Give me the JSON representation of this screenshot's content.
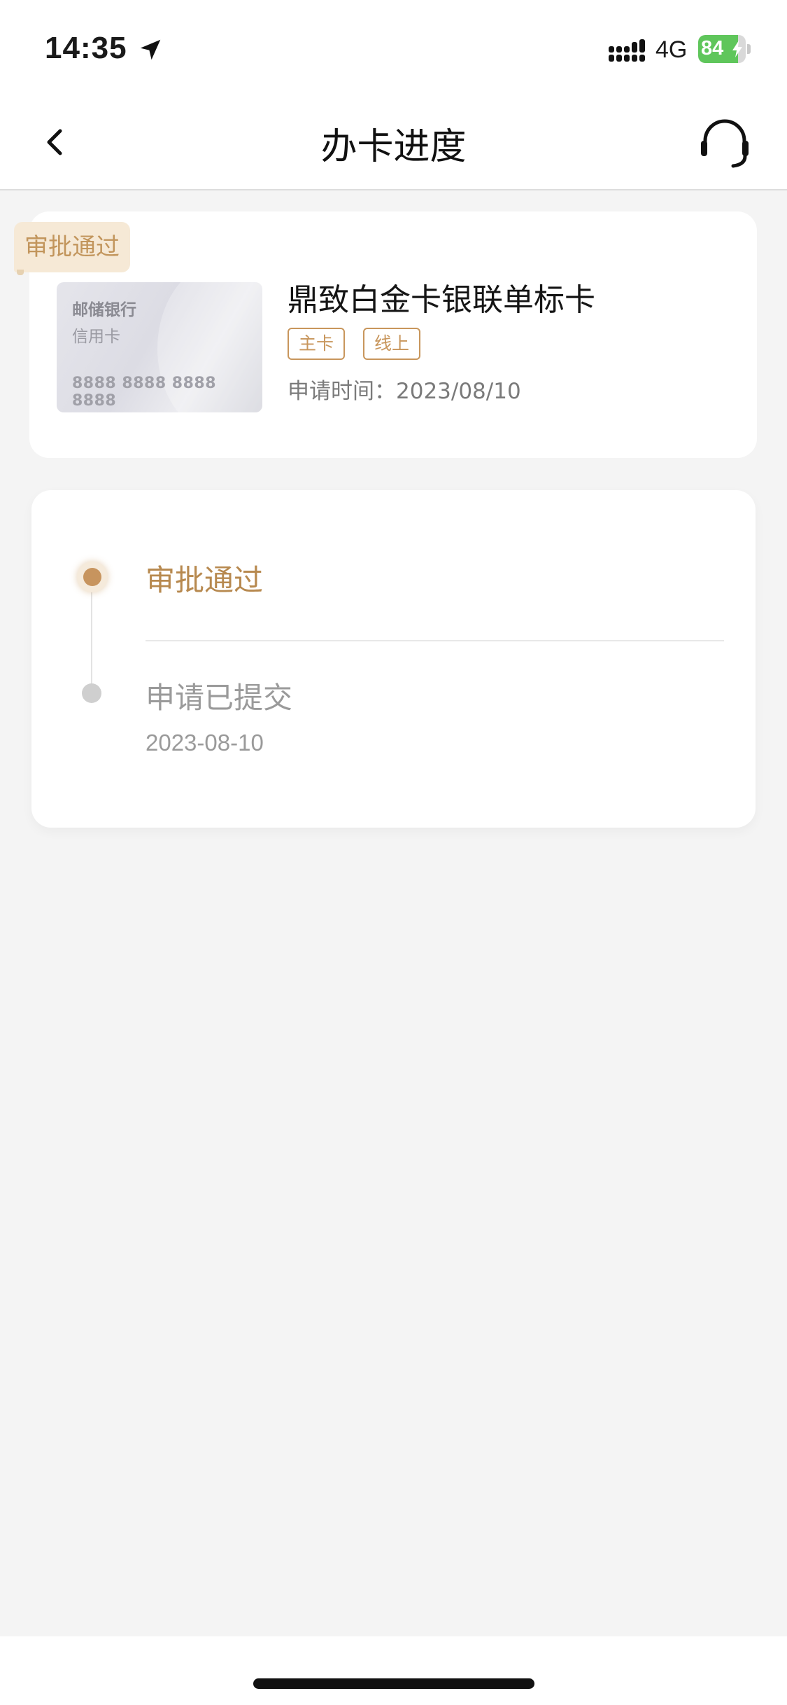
{
  "status_bar": {
    "time": "14:35",
    "network": "4G",
    "battery_level": "84",
    "battery_fraction": 0.84
  },
  "nav": {
    "title": "办卡进度",
    "back_icon": "chevron-left-icon",
    "service_icon": "headset-icon"
  },
  "card": {
    "status_badge": "审批通过",
    "image": {
      "bank_name": "邮储银行",
      "card_type": "信用卡",
      "number": "8888 8888 8888 8888"
    },
    "name": "鼎致白金卡银联单标卡",
    "tags": [
      "主卡",
      "线上"
    ],
    "apply_time_label": "申请时间：",
    "apply_time_value": "2023/08/10"
  },
  "progress": {
    "steps": [
      {
        "title": "审批通过",
        "date": "",
        "current": true
      },
      {
        "title": "申请已提交",
        "date": "2023-08-10",
        "current": false
      }
    ]
  },
  "colors": {
    "accent": "#c7945e",
    "badge_bg": "#f6e9d6",
    "page_bg": "#f4f4f4",
    "battery_green": "#5fc65b"
  }
}
